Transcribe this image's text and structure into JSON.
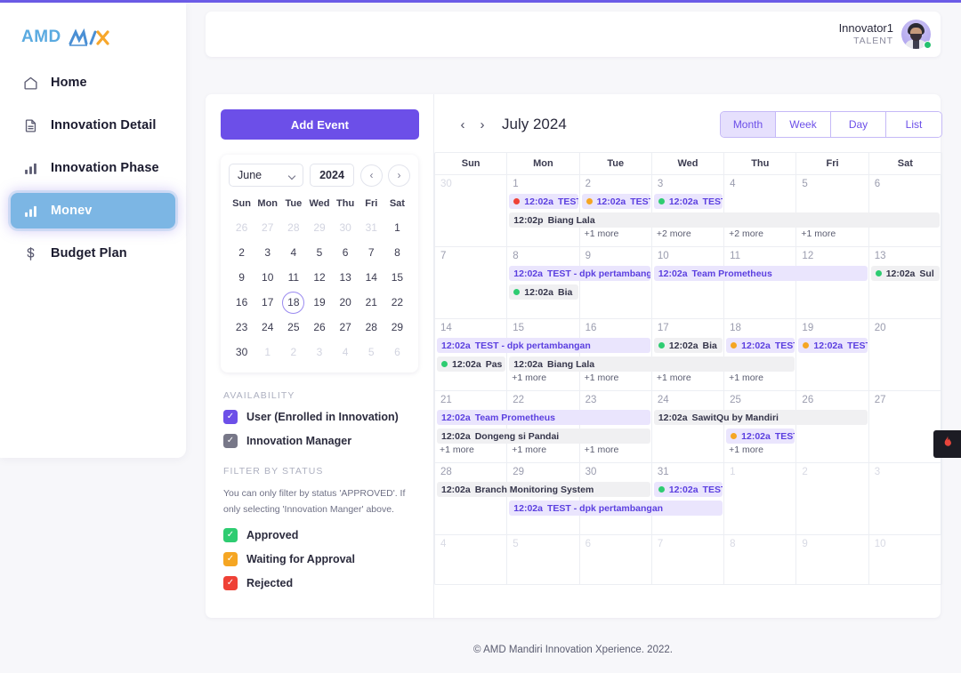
{
  "brand": {
    "amd": "AMD",
    "mix": "MIX"
  },
  "sidebar": {
    "items": [
      {
        "label": "Home",
        "icon": "home-icon",
        "active": false
      },
      {
        "label": "Innovation Detail",
        "icon": "document-icon",
        "active": false
      },
      {
        "label": "Innovation Phase",
        "icon": "bar-chart-icon",
        "active": false
      },
      {
        "label": "Monev",
        "icon": "bar-chart-icon",
        "active": true
      },
      {
        "label": "Budget Plan",
        "icon": "dollar-icon",
        "active": false
      }
    ]
  },
  "header": {
    "user_name": "Innovator1",
    "user_role": "TALENT",
    "avatar": "user-avatar",
    "status": "online"
  },
  "left_pane": {
    "add_event_label": "Add Event",
    "mini_calendar": {
      "month": "June",
      "year": "2024",
      "prev_label": "‹",
      "next_label": "›",
      "dow": [
        "Sun",
        "Mon",
        "Tue",
        "Wed",
        "Thu",
        "Fri",
        "Sat"
      ],
      "today": 18,
      "weeks": [
        [
          {
            "d": "26",
            "o": true
          },
          {
            "d": "27",
            "o": true
          },
          {
            "d": "28",
            "o": true
          },
          {
            "d": "29",
            "o": true
          },
          {
            "d": "30",
            "o": true
          },
          {
            "d": "31",
            "o": true
          },
          {
            "d": "1",
            "o": false
          }
        ],
        [
          {
            "d": "2",
            "o": false
          },
          {
            "d": "3",
            "o": false
          },
          {
            "d": "4",
            "o": false
          },
          {
            "d": "5",
            "o": false
          },
          {
            "d": "6",
            "o": false
          },
          {
            "d": "7",
            "o": false
          },
          {
            "d": "8",
            "o": false
          }
        ],
        [
          {
            "d": "9",
            "o": false
          },
          {
            "d": "10",
            "o": false
          },
          {
            "d": "11",
            "o": false
          },
          {
            "d": "12",
            "o": false
          },
          {
            "d": "13",
            "o": false
          },
          {
            "d": "14",
            "o": false
          },
          {
            "d": "15",
            "o": false
          }
        ],
        [
          {
            "d": "16",
            "o": false
          },
          {
            "d": "17",
            "o": false
          },
          {
            "d": "18",
            "o": false
          },
          {
            "d": "19",
            "o": false
          },
          {
            "d": "20",
            "o": false
          },
          {
            "d": "21",
            "o": false
          },
          {
            "d": "22",
            "o": false
          }
        ],
        [
          {
            "d": "23",
            "o": false
          },
          {
            "d": "24",
            "o": false
          },
          {
            "d": "25",
            "o": false
          },
          {
            "d": "26",
            "o": false
          },
          {
            "d": "27",
            "o": false
          },
          {
            "d": "28",
            "o": false
          },
          {
            "d": "29",
            "o": false
          }
        ],
        [
          {
            "d": "30",
            "o": false
          },
          {
            "d": "1",
            "o": true
          },
          {
            "d": "2",
            "o": true
          },
          {
            "d": "3",
            "o": true
          },
          {
            "d": "4",
            "o": true
          },
          {
            "d": "5",
            "o": true
          },
          {
            "d": "6",
            "o": true
          }
        ]
      ]
    },
    "availability": {
      "title": "AVAILABILITY",
      "options": [
        {
          "label": "User (Enrolled in Innovation)",
          "checked": true,
          "color": "#6c4fe8"
        },
        {
          "label": "Innovation Manager",
          "checked": true,
          "color": "#777788"
        }
      ]
    },
    "filter_by_status": {
      "title": "FILTER BY STATUS",
      "hint": "You can only filter by status 'APPROVED'. If only selecting 'Innovation Manger' above.",
      "options": [
        {
          "label": "Approved",
          "checked": true,
          "color": "#2ecc71"
        },
        {
          "label": "Waiting for Approval",
          "checked": true,
          "color": "#f5a623"
        },
        {
          "label": "Rejected",
          "checked": true,
          "color": "#ef4136"
        }
      ]
    }
  },
  "calendar": {
    "prev_label": "‹",
    "next_label": "›",
    "title": "July 2024",
    "views": [
      {
        "label": "Month",
        "active": true
      },
      {
        "label": "Week",
        "active": false
      },
      {
        "label": "Day",
        "active": false
      },
      {
        "label": "List",
        "active": false
      }
    ],
    "dow": [
      "Sun",
      "Mon",
      "Tue",
      "Wed",
      "Thu",
      "Fri",
      "Sat"
    ],
    "weeks": [
      {
        "days": [
          {
            "num": "30",
            "other": true,
            "more": null
          },
          {
            "num": "1",
            "other": false,
            "more": null
          },
          {
            "num": "2",
            "other": false,
            "more": "+1 more"
          },
          {
            "num": "3",
            "other": false,
            "more": "+2 more"
          },
          {
            "num": "4",
            "other": false,
            "more": "+2 more"
          },
          {
            "num": "5",
            "other": false,
            "more": "+1 more"
          },
          {
            "num": "6",
            "other": false,
            "more": null
          }
        ],
        "events": [
          {
            "time": "12:02a",
            "name": "TEST",
            "style": "purple",
            "dot": "#ef4136",
            "col": 1,
            "span": 1,
            "row": 0
          },
          {
            "time": "12:02a",
            "name": "TEST",
            "style": "purple",
            "dot": "#f5a623",
            "col": 2,
            "span": 1,
            "row": 0
          },
          {
            "time": "12:02a",
            "name": "TEST",
            "style": "purple",
            "dot": "#2ecc71",
            "col": 3,
            "span": 1,
            "row": 0
          },
          {
            "time": "12:02p",
            "name": "Biang Lala",
            "style": "grey",
            "dot": null,
            "col": 1,
            "span": 6,
            "row": 1
          }
        ]
      },
      {
        "days": [
          {
            "num": "7",
            "other": false,
            "more": null
          },
          {
            "num": "8",
            "other": false,
            "more": null
          },
          {
            "num": "9",
            "other": false,
            "more": null
          },
          {
            "num": "10",
            "other": false,
            "more": null
          },
          {
            "num": "11",
            "other": false,
            "more": null
          },
          {
            "num": "12",
            "other": false,
            "more": null
          },
          {
            "num": "13",
            "other": false,
            "more": null
          }
        ],
        "events": [
          {
            "time": "12:02a",
            "name": "TEST - dpk pertambanga",
            "style": "purple",
            "dot": null,
            "col": 1,
            "span": 2,
            "row": 0
          },
          {
            "time": "12:02a",
            "name": "Team Prometheus",
            "style": "purple",
            "dot": null,
            "col": 3,
            "span": 3,
            "row": 0
          },
          {
            "time": "12:02a",
            "name": "Sul",
            "style": "grey",
            "dot": "#2ecc71",
            "col": 6,
            "span": 1,
            "row": 0
          },
          {
            "time": "12:02a",
            "name": "Bia",
            "style": "grey",
            "dot": "#2ecc71",
            "col": 1,
            "span": 1,
            "row": 1
          }
        ]
      },
      {
        "days": [
          {
            "num": "14",
            "other": false,
            "more": null
          },
          {
            "num": "15",
            "other": false,
            "more": "+1 more"
          },
          {
            "num": "16",
            "other": false,
            "more": "+1 more"
          },
          {
            "num": "17",
            "other": false,
            "more": "+1 more"
          },
          {
            "num": "18",
            "other": false,
            "more": "+1 more"
          },
          {
            "num": "19",
            "other": false,
            "more": null
          },
          {
            "num": "20",
            "other": false,
            "more": null
          }
        ],
        "events": [
          {
            "time": "12:02a",
            "name": "TEST - dpk pertambangan",
            "style": "purple",
            "dot": null,
            "col": 0,
            "span": 3,
            "row": 0
          },
          {
            "time": "12:02a",
            "name": "Bia",
            "style": "grey",
            "dot": "#2ecc71",
            "col": 3,
            "span": 1,
            "row": 0
          },
          {
            "time": "12:02a",
            "name": "TEST",
            "style": "purple",
            "dot": "#f5a623",
            "col": 4,
            "span": 1,
            "row": 0
          },
          {
            "time": "12:02a",
            "name": "TEST",
            "style": "purple",
            "dot": "#f5a623",
            "col": 5,
            "span": 1,
            "row": 0
          },
          {
            "time": "12:02a",
            "name": "Pas",
            "style": "grey",
            "dot": "#2ecc71",
            "col": 0,
            "span": 1,
            "row": 1
          },
          {
            "time": "12:02a",
            "name": "Biang Lala",
            "style": "grey",
            "dot": null,
            "col": 1,
            "span": 4,
            "row": 1
          }
        ]
      },
      {
        "days": [
          {
            "num": "21",
            "other": false,
            "more": "+1 more"
          },
          {
            "num": "22",
            "other": false,
            "more": "+1 more"
          },
          {
            "num": "23",
            "other": false,
            "more": "+1 more"
          },
          {
            "num": "24",
            "other": false,
            "more": null
          },
          {
            "num": "25",
            "other": false,
            "more": "+1 more"
          },
          {
            "num": "26",
            "other": false,
            "more": null
          },
          {
            "num": "27",
            "other": false,
            "more": null
          }
        ],
        "events": [
          {
            "time": "12:02a",
            "name": "Team Prometheus",
            "style": "purple",
            "dot": null,
            "col": 0,
            "span": 3,
            "row": 0
          },
          {
            "time": "12:02a",
            "name": "SawitQu by Mandiri",
            "style": "grey",
            "dot": null,
            "col": 3,
            "span": 3,
            "row": 0
          },
          {
            "time": "12:02a",
            "name": "Dongeng si Pandai",
            "style": "grey",
            "dot": null,
            "col": 0,
            "span": 3,
            "row": 1
          },
          {
            "time": "12:02a",
            "name": "TEST",
            "style": "purple",
            "dot": "#f5a623",
            "col": 4,
            "span": 1,
            "row": 1
          }
        ]
      },
      {
        "days": [
          {
            "num": "28",
            "other": false,
            "more": null
          },
          {
            "num": "29",
            "other": false,
            "more": null
          },
          {
            "num": "30",
            "other": false,
            "more": null
          },
          {
            "num": "31",
            "other": false,
            "more": null
          },
          {
            "num": "1",
            "other": true,
            "more": null
          },
          {
            "num": "2",
            "other": true,
            "more": null
          },
          {
            "num": "3",
            "other": true,
            "more": null
          }
        ],
        "events": [
          {
            "time": "12:02a",
            "name": "Branch Monitoring System",
            "style": "grey",
            "dot": null,
            "col": 0,
            "span": 3,
            "row": 0
          },
          {
            "time": "12:02a",
            "name": "TEST",
            "style": "purple",
            "dot": "#2ecc71",
            "col": 3,
            "span": 1,
            "row": 0
          },
          {
            "time": "12:02a",
            "name": "TEST - dpk pertambangan",
            "style": "purple",
            "dot": null,
            "col": 1,
            "span": 3,
            "row": 1
          }
        ]
      },
      {
        "days": [
          {
            "num": "4",
            "other": true,
            "more": null
          },
          {
            "num": "5",
            "other": true,
            "more": null
          },
          {
            "num": "6",
            "other": true,
            "more": null
          },
          {
            "num": "7",
            "other": true,
            "more": null
          },
          {
            "num": "8",
            "other": true,
            "more": null
          },
          {
            "num": "9",
            "other": true,
            "more": null
          },
          {
            "num": "10",
            "other": true,
            "more": null
          }
        ],
        "events": []
      }
    ]
  },
  "fire_widget": {
    "icon": "fire-icon"
  },
  "footer": {
    "text": "© AMD Mandiri Innovation Xperience. 2022."
  }
}
